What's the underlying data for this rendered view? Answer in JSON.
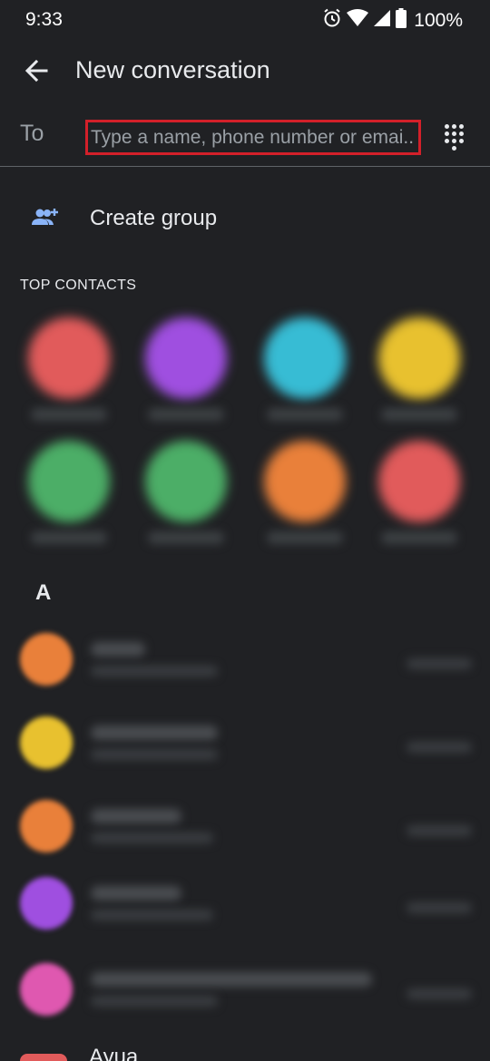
{
  "status_bar": {
    "time": "9:33",
    "battery_text": "100%",
    "icons": [
      "alarm-icon",
      "wifi-icon",
      "signal-icon",
      "battery-icon"
    ]
  },
  "app_bar": {
    "title": "New conversation",
    "back_icon": "arrow-back-icon"
  },
  "to_row": {
    "label": "To",
    "placeholder": "Type a name, phone number or emai..",
    "value": "",
    "dialpad_icon": "dialpad-icon"
  },
  "create_group": {
    "label": "Create group",
    "icon": "group-add-icon"
  },
  "top_contacts": {
    "title": "TOP CONTACTS",
    "items": [
      {
        "color": "#e15b5b"
      },
      {
        "color": "#9f4fe0"
      },
      {
        "color": "#37bcd4"
      },
      {
        "color": "#e8c12f"
      },
      {
        "color": "#4cae67"
      },
      {
        "color": "#4cae67"
      },
      {
        "color": "#e9803a"
      },
      {
        "color": "#e15b5b"
      }
    ]
  },
  "contact_list": {
    "section_letter": "A",
    "rows": [
      {
        "color": "#e9803a"
      },
      {
        "color": "#e8c12f"
      },
      {
        "color": "#e9803a"
      },
      {
        "color": "#9f4fe0"
      },
      {
        "color": "#df58b0"
      },
      {
        "color": "#e15b5b"
      }
    ],
    "partial_name": "Ayua"
  },
  "colors": {
    "background": "#202124",
    "highlight_border": "#d3202a",
    "accent_blue": "#8ab4f8"
  }
}
